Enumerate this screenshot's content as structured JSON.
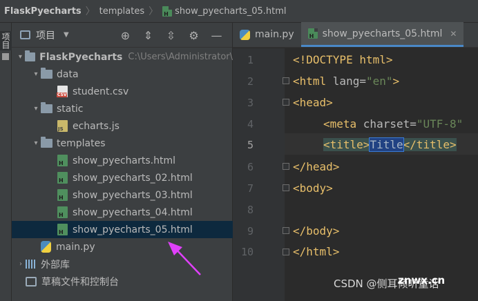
{
  "breadcrumb": {
    "project": "FlaskPyecharts",
    "folder": "templates",
    "file": "show_pyecharts_05.html"
  },
  "toolstrip": {
    "label": "项目"
  },
  "project_panel": {
    "title": "项目",
    "tools": [
      "target-icon",
      "expand-all-icon",
      "collapse-all-icon",
      "gear-icon",
      "minimize-icon"
    ],
    "tree": [
      {
        "depth": 0,
        "arrow": "▾",
        "kind": "folder",
        "label": "FlaskPyecharts",
        "path": "C:\\Users\\Administrator\\"
      },
      {
        "depth": 1,
        "arrow": "▾",
        "kind": "folder",
        "label": "data"
      },
      {
        "depth": 2,
        "arrow": "",
        "kind": "csv",
        "label": "student.csv"
      },
      {
        "depth": 1,
        "arrow": "▾",
        "kind": "folder",
        "label": "static"
      },
      {
        "depth": 2,
        "arrow": "",
        "kind": "js",
        "label": "echarts.js"
      },
      {
        "depth": 1,
        "arrow": "▾",
        "kind": "folder",
        "label": "templates"
      },
      {
        "depth": 2,
        "arrow": "",
        "kind": "html",
        "label": "show_pyecharts.html"
      },
      {
        "depth": 2,
        "arrow": "",
        "kind": "html",
        "label": "show_pyecharts_02.html"
      },
      {
        "depth": 2,
        "arrow": "",
        "kind": "html",
        "label": "show_pyecharts_03.html"
      },
      {
        "depth": 2,
        "arrow": "",
        "kind": "html",
        "label": "show_pyecharts_04.html"
      },
      {
        "depth": 2,
        "arrow": "",
        "kind": "html",
        "label": "show_pyecharts_05.html",
        "selected": true
      },
      {
        "depth": 1,
        "arrow": "",
        "kind": "py",
        "label": "main.py"
      },
      {
        "depth": 0,
        "arrow": "›",
        "kind": "lib",
        "label": "外部库"
      },
      {
        "depth": 0,
        "arrow": "",
        "kind": "scratch",
        "label": "草稿文件和控制台"
      }
    ]
  },
  "editor": {
    "tabs": [
      {
        "label": "main.py",
        "active": false
      },
      {
        "label": "show_pyecharts_05.html",
        "active": true
      }
    ],
    "line_numbers": [
      "1",
      "2",
      "3",
      "4",
      "5",
      "6",
      "7",
      "8",
      "9",
      "10"
    ],
    "current_line": "5",
    "code": {
      "l1": "<!DOCTYPE html>",
      "l2_open": "<html ",
      "l2_attr": "lang=",
      "l2_str": "\"en\"",
      "l2_close": ">",
      "l3": "<head>",
      "l4_open": "<meta ",
      "l4_attr": "charset=",
      "l4_str": "\"UTF-8\"",
      "l5_open": "<title>",
      "l5_text": "Title",
      "l5_close": "</title>",
      "l6": "</head>",
      "l7": "<body>",
      "l9": "</body>",
      "l10": "</html>"
    }
  },
  "watermark": {
    "text": "CSDN @侧耳倾听童话",
    "logo": "znwx.cn"
  },
  "colors": {
    "annotation_arrow": "#e040fb",
    "selection": "#0d293e",
    "accent_tab": "#4a88c7"
  }
}
